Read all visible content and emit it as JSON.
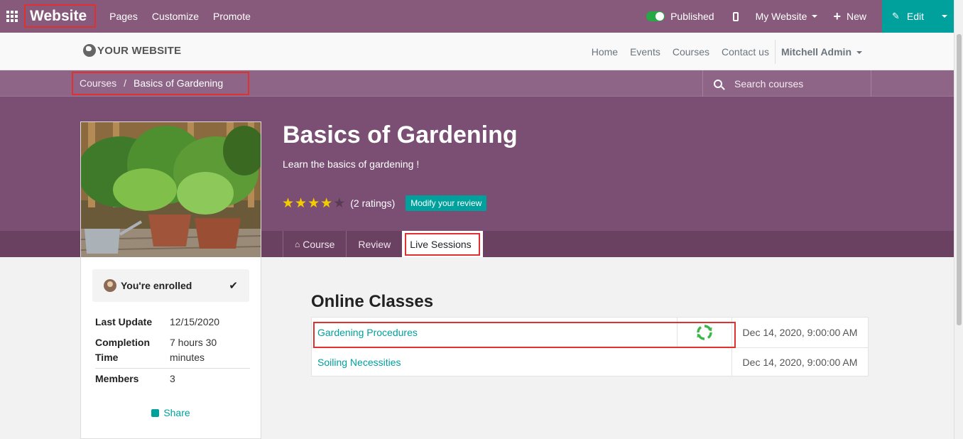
{
  "topbar": {
    "brand": "Website",
    "menu": [
      "Pages",
      "Customize",
      "Promote"
    ],
    "published_label": "Published",
    "website_selector": "My Website",
    "new_label": "New",
    "edit_label": "Edit"
  },
  "header": {
    "logo_text": "YOUR WEBSITE",
    "nav": [
      "Home",
      "Events",
      "Courses",
      "Contact us"
    ],
    "user": "Mitchell Admin"
  },
  "breadcrumb": {
    "root": "Courses",
    "separator": "/",
    "current": "Basics of Gardening"
  },
  "search": {
    "placeholder": "Search courses"
  },
  "course": {
    "title": "Basics of Gardening",
    "subtitle": "Learn the basics of gardening !",
    "rating_stars": 4,
    "rating_max": 5,
    "ratings_text": "(2 ratings)",
    "modify_review": "Modify your review"
  },
  "tabs": [
    "Course",
    "Review",
    "Live Sessions"
  ],
  "sidebar": {
    "enrolled_text": "You're enrolled",
    "info": [
      {
        "key": "Last Update",
        "value": "12/15/2020"
      },
      {
        "key": "Completion Time",
        "value": "7 hours 30 minutes"
      },
      {
        "key": "Members",
        "value": "3"
      }
    ],
    "share_label": "Share"
  },
  "online_classes": {
    "title": "Online Classes",
    "rows": [
      {
        "name": "Gardening Procedures",
        "date": "Dec 14, 2020, 9:00:00 AM",
        "sync_icon": true
      },
      {
        "name": "Soiling Necessities",
        "date": "Dec 14, 2020, 9:00:00 AM",
        "sync_icon": false
      }
    ]
  },
  "colors": {
    "brand_purple": "#875a7b",
    "accent_teal": "#00a09d",
    "highlight_red": "#e03030",
    "star_gold": "#f3cc00"
  }
}
